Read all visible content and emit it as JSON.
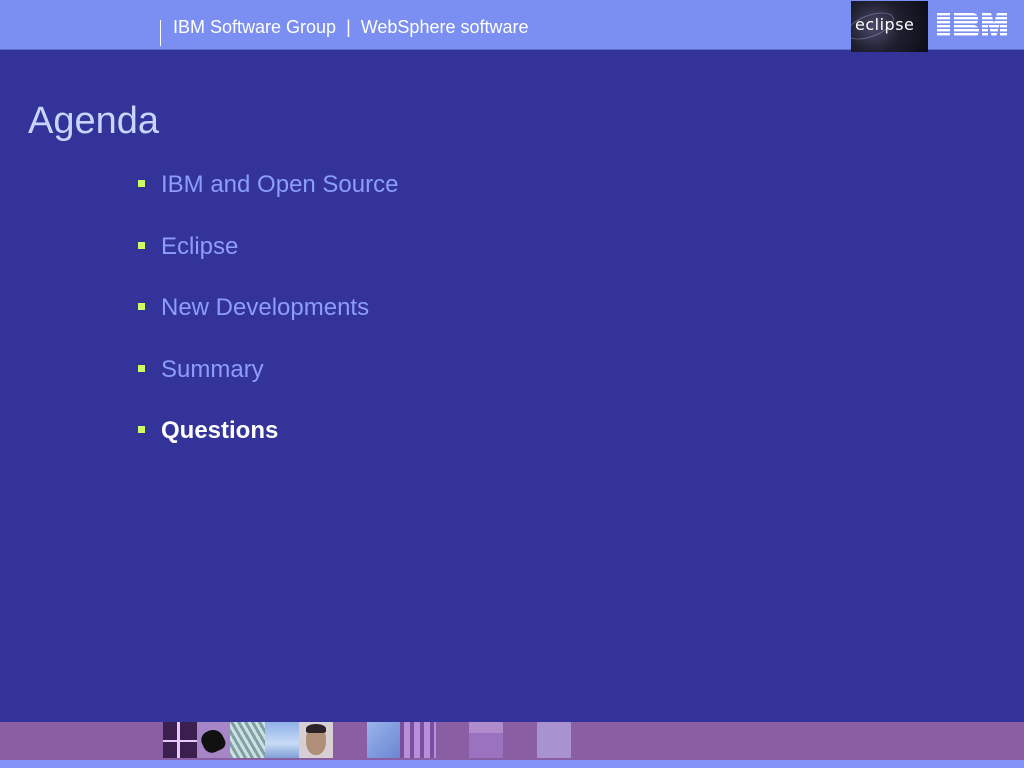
{
  "header": {
    "title": "IBM Software Group  |  WebSphere software",
    "eclipse_logo_text": "eclipse",
    "ibm_logo_text": "IBM"
  },
  "slide": {
    "title": "Agenda",
    "items": [
      {
        "label": "IBM and Open Source",
        "active": false
      },
      {
        "label": "Eclipse",
        "active": false
      },
      {
        "label": "New Developments",
        "active": false
      },
      {
        "label": "Summary",
        "active": false
      },
      {
        "label": "Questions",
        "active": true
      }
    ]
  },
  "colors": {
    "background": "#333399",
    "header": "#7b8ff2",
    "footer": "#8a5ea3",
    "bullet": "#ccff66",
    "item_text": "#8c9cff",
    "active_text": "#ffffff"
  }
}
